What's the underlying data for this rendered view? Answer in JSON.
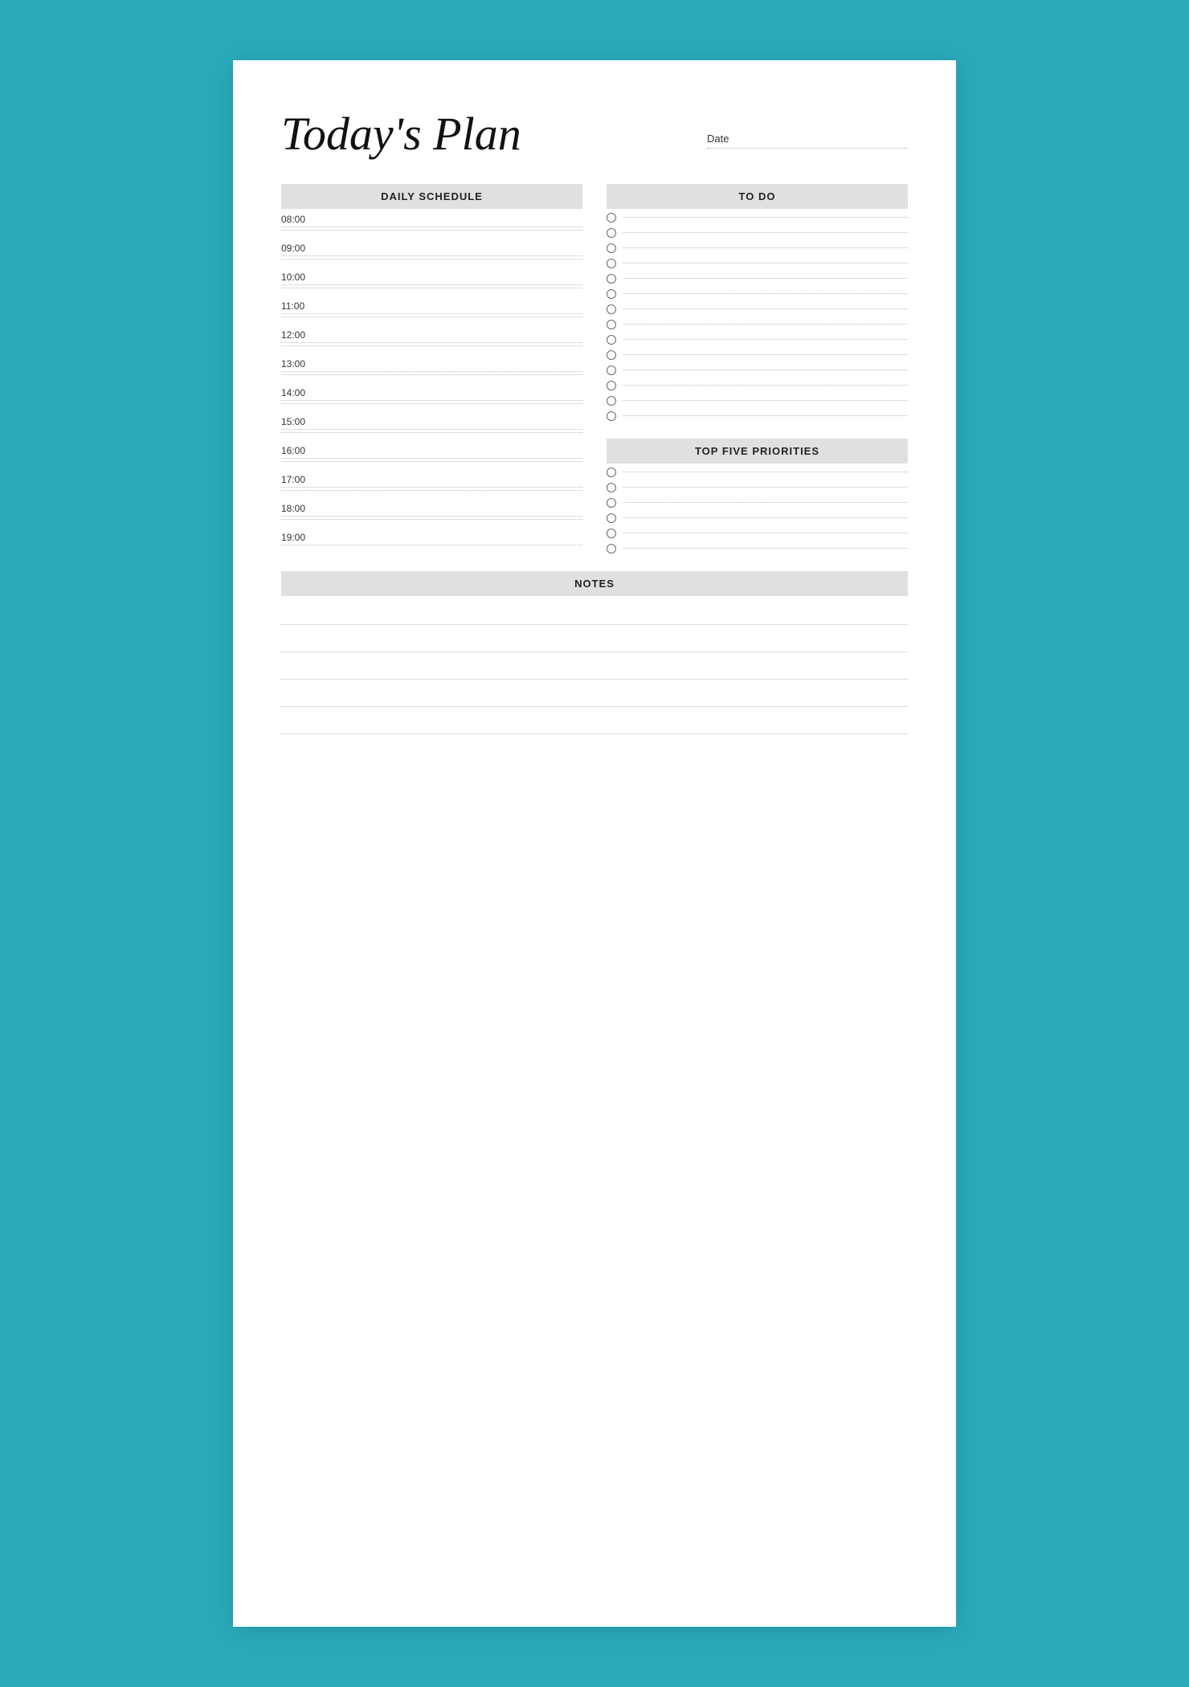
{
  "header": {
    "title": "Today's Plan",
    "date_label": "Date"
  },
  "schedule": {
    "header": "DAILY SCHEDULE",
    "times": [
      "08:00",
      "09:00",
      "10:00",
      "11:00",
      "12:00",
      "13:00",
      "14:00",
      "15:00",
      "16:00",
      "17:00",
      "18:00",
      "19:00"
    ]
  },
  "todo": {
    "header": "TO DO",
    "items": 14
  },
  "priorities": {
    "header": "TOP FIVE PRIORITIES",
    "items": 6
  },
  "notes": {
    "header": "NOTES",
    "lines": 5
  }
}
